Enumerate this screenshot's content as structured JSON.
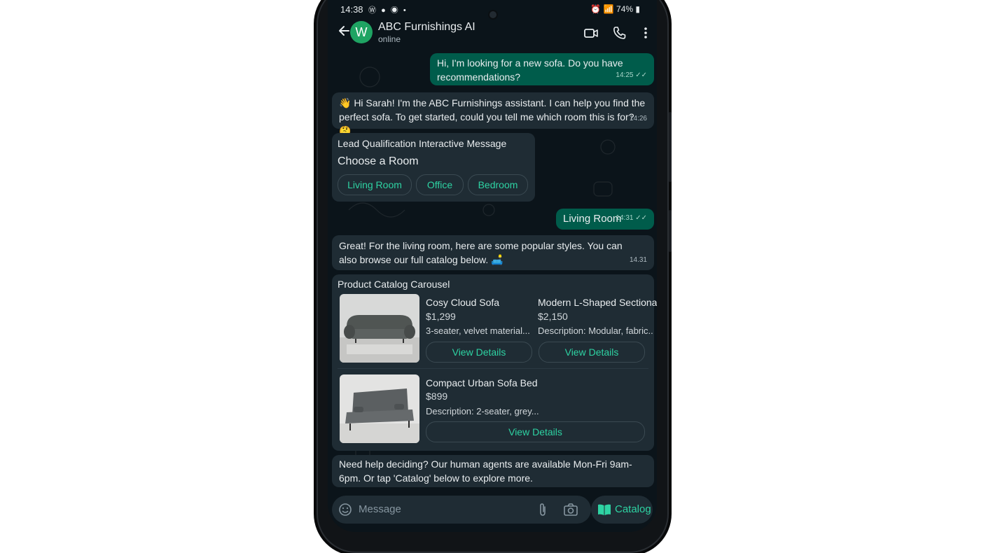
{
  "status_bar": {
    "time": "14:38",
    "icons_left": [
      "whatsapp-icon",
      "messenger-icon",
      "messenger-icon",
      "dot-icon"
    ],
    "battery": "74%"
  },
  "header": {
    "avatar_letter": "W",
    "name": "ABC Furnishings AI",
    "status": "online"
  },
  "messages": {
    "m1": {
      "text": "Hi, I'm looking for a new sofa. Do you have recommendations?",
      "time": "14:25"
    },
    "m2": {
      "text": "👋 Hi Sarah! I'm the ABC Furnishings assistant. I can help you find the perfect sofa. To get started, could you tell me which room this is for? 🤔",
      "time": "14:26"
    },
    "m3": {
      "title": "Lead Qualification Interactive Message",
      "prompt": "Choose a Room",
      "options": [
        "Living Room",
        "Office",
        "Bedroom"
      ]
    },
    "m4": {
      "text": "Living Room",
      "time": "14:31"
    },
    "m5": {
      "text": "Great! For the living room, here are some popular styles. You can also browse our full catalog below. 🛋️",
      "time": "14.31"
    },
    "m6": {
      "title": "Product Catalog Carousel",
      "products": [
        {
          "name": "Cosy Cloud Sofa",
          "price": "$1,299",
          "desc": "3-seater, velvet material...",
          "button": "View Details"
        },
        {
          "name": "Modern L-Shaped Sectional",
          "price": "$2,150",
          "desc": "Description: Modular, fabric...",
          "button": "View Details"
        },
        {
          "name": "Compact Urban Sofa Bed",
          "price": "$899",
          "desc": "Description: 2-seater, grey...",
          "button": "View Details"
        }
      ]
    },
    "m7": {
      "text": "Need help deciding? Our human agents are available Mon-Fri 9am-6pm. Or tap 'Catalog' below to explore more."
    }
  },
  "composer": {
    "placeholder": "Message",
    "catalog_label": "Catalog"
  },
  "colors": {
    "accent": "#2ed3a3",
    "outgoing_bubble": "#005c4b",
    "incoming_bubble": "#1f2c34",
    "background": "#0b141a"
  }
}
